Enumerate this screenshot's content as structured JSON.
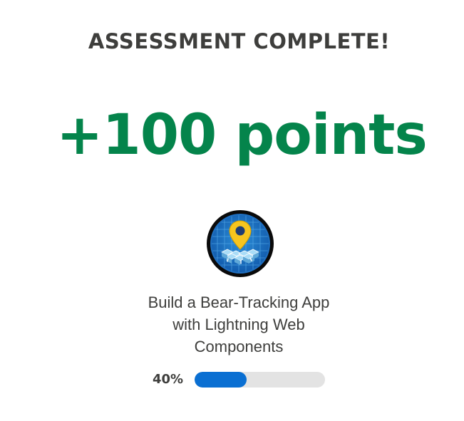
{
  "assessment": {
    "title": "ASSESSMENT COMPLETE!",
    "points_text": "+100 points",
    "badge_icon": "bear-tracking-map-pin-badge-icon",
    "module_title_lines": [
      "Build a Bear-Tracking App",
      "with Lightning Web",
      "Components"
    ],
    "progress": {
      "label": "40%",
      "fraction": 0.4
    }
  },
  "colors": {
    "title": "#3e3e3c",
    "points": "#04844b",
    "progress_fill": "#0a6fd2",
    "progress_track": "#e3e3e3"
  }
}
